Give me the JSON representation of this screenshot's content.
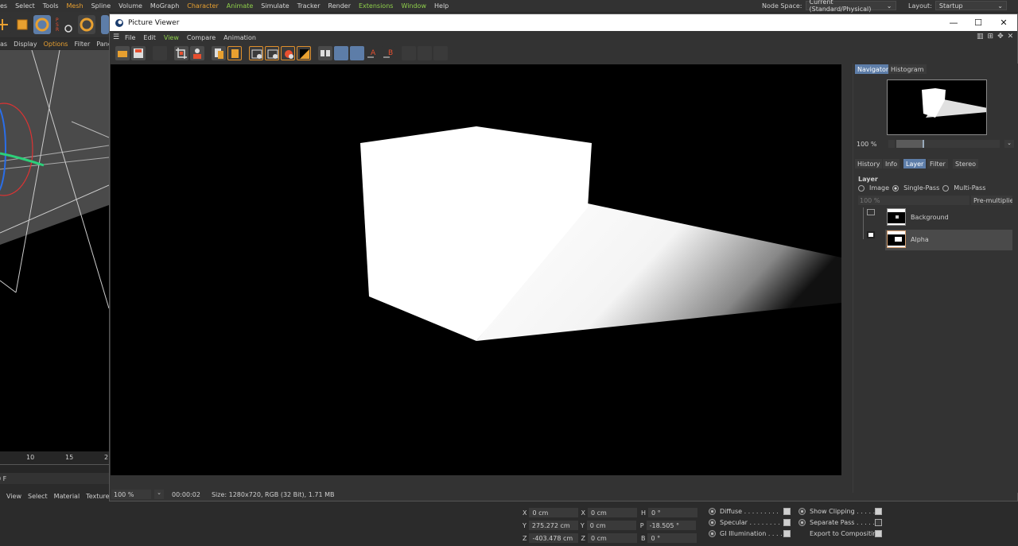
{
  "app_menu": [
    "es",
    "Select",
    "Tools",
    "Mesh",
    "Spline",
    "Volume",
    "MoGraph",
    "Character",
    "Animate",
    "Simulate",
    "Tracker",
    "Render",
    "Extensions",
    "Window",
    "Help"
  ],
  "node_space": {
    "label": "Node Space:",
    "value": "Current (Standard/Physical)"
  },
  "layout": {
    "label": "Layout:",
    "value": "Startup"
  },
  "left_menu": [
    "as",
    "Display",
    "Options",
    "Filter",
    "Pane"
  ],
  "timeline": {
    "ticks": [
      "10",
      "15",
      "2"
    ],
    "frame": "0 F"
  },
  "bottom_menu": [
    "View",
    "Select",
    "Material",
    "Texture"
  ],
  "picture_viewer": {
    "title": "Picture Viewer",
    "menu": [
      "File",
      "Edit",
      "View",
      "Compare",
      "Animation"
    ],
    "status": {
      "zoom": "100 %",
      "time": "00:00:02",
      "info": "Size: 1280x720, RGB (32 Bit), 1.71 MB"
    }
  },
  "right_panel": {
    "top_tabs": [
      "Navigator",
      "Histogram"
    ],
    "nav_zoom": "100 %",
    "mid_tabs": [
      "History",
      "Info",
      "Layer",
      "Filter",
      "Stereo"
    ],
    "layer_heading": "Layer",
    "layer_mode_options": [
      "Image",
      "Single-Pass",
      "Multi-Pass"
    ],
    "opacity": "100 %",
    "blend_mode": "Pre-multiplied",
    "layers": [
      {
        "name": "Background"
      },
      {
        "name": "Alpha"
      }
    ]
  },
  "coords": {
    "x": {
      "pos": "0 cm",
      "size": "0 cm",
      "rot_label": "H",
      "rot": "0 °"
    },
    "y": {
      "pos": "275.272 cm",
      "size": "0 cm",
      "rot_label": "P",
      "rot": "-18.505 °"
    },
    "z": {
      "pos": "-403.478 cm",
      "size": "0 cm",
      "rot_label": "B",
      "rot": "0 °"
    }
  },
  "render_opts": {
    "left": [
      "Diffuse . . . . . . . . .",
      "Specular . . . . . . . .",
      "GI Illumination . . . ."
    ],
    "right": [
      "Show Clipping . . . . .",
      "Separate Pass . . . . .",
      "Export to Compositing"
    ]
  }
}
